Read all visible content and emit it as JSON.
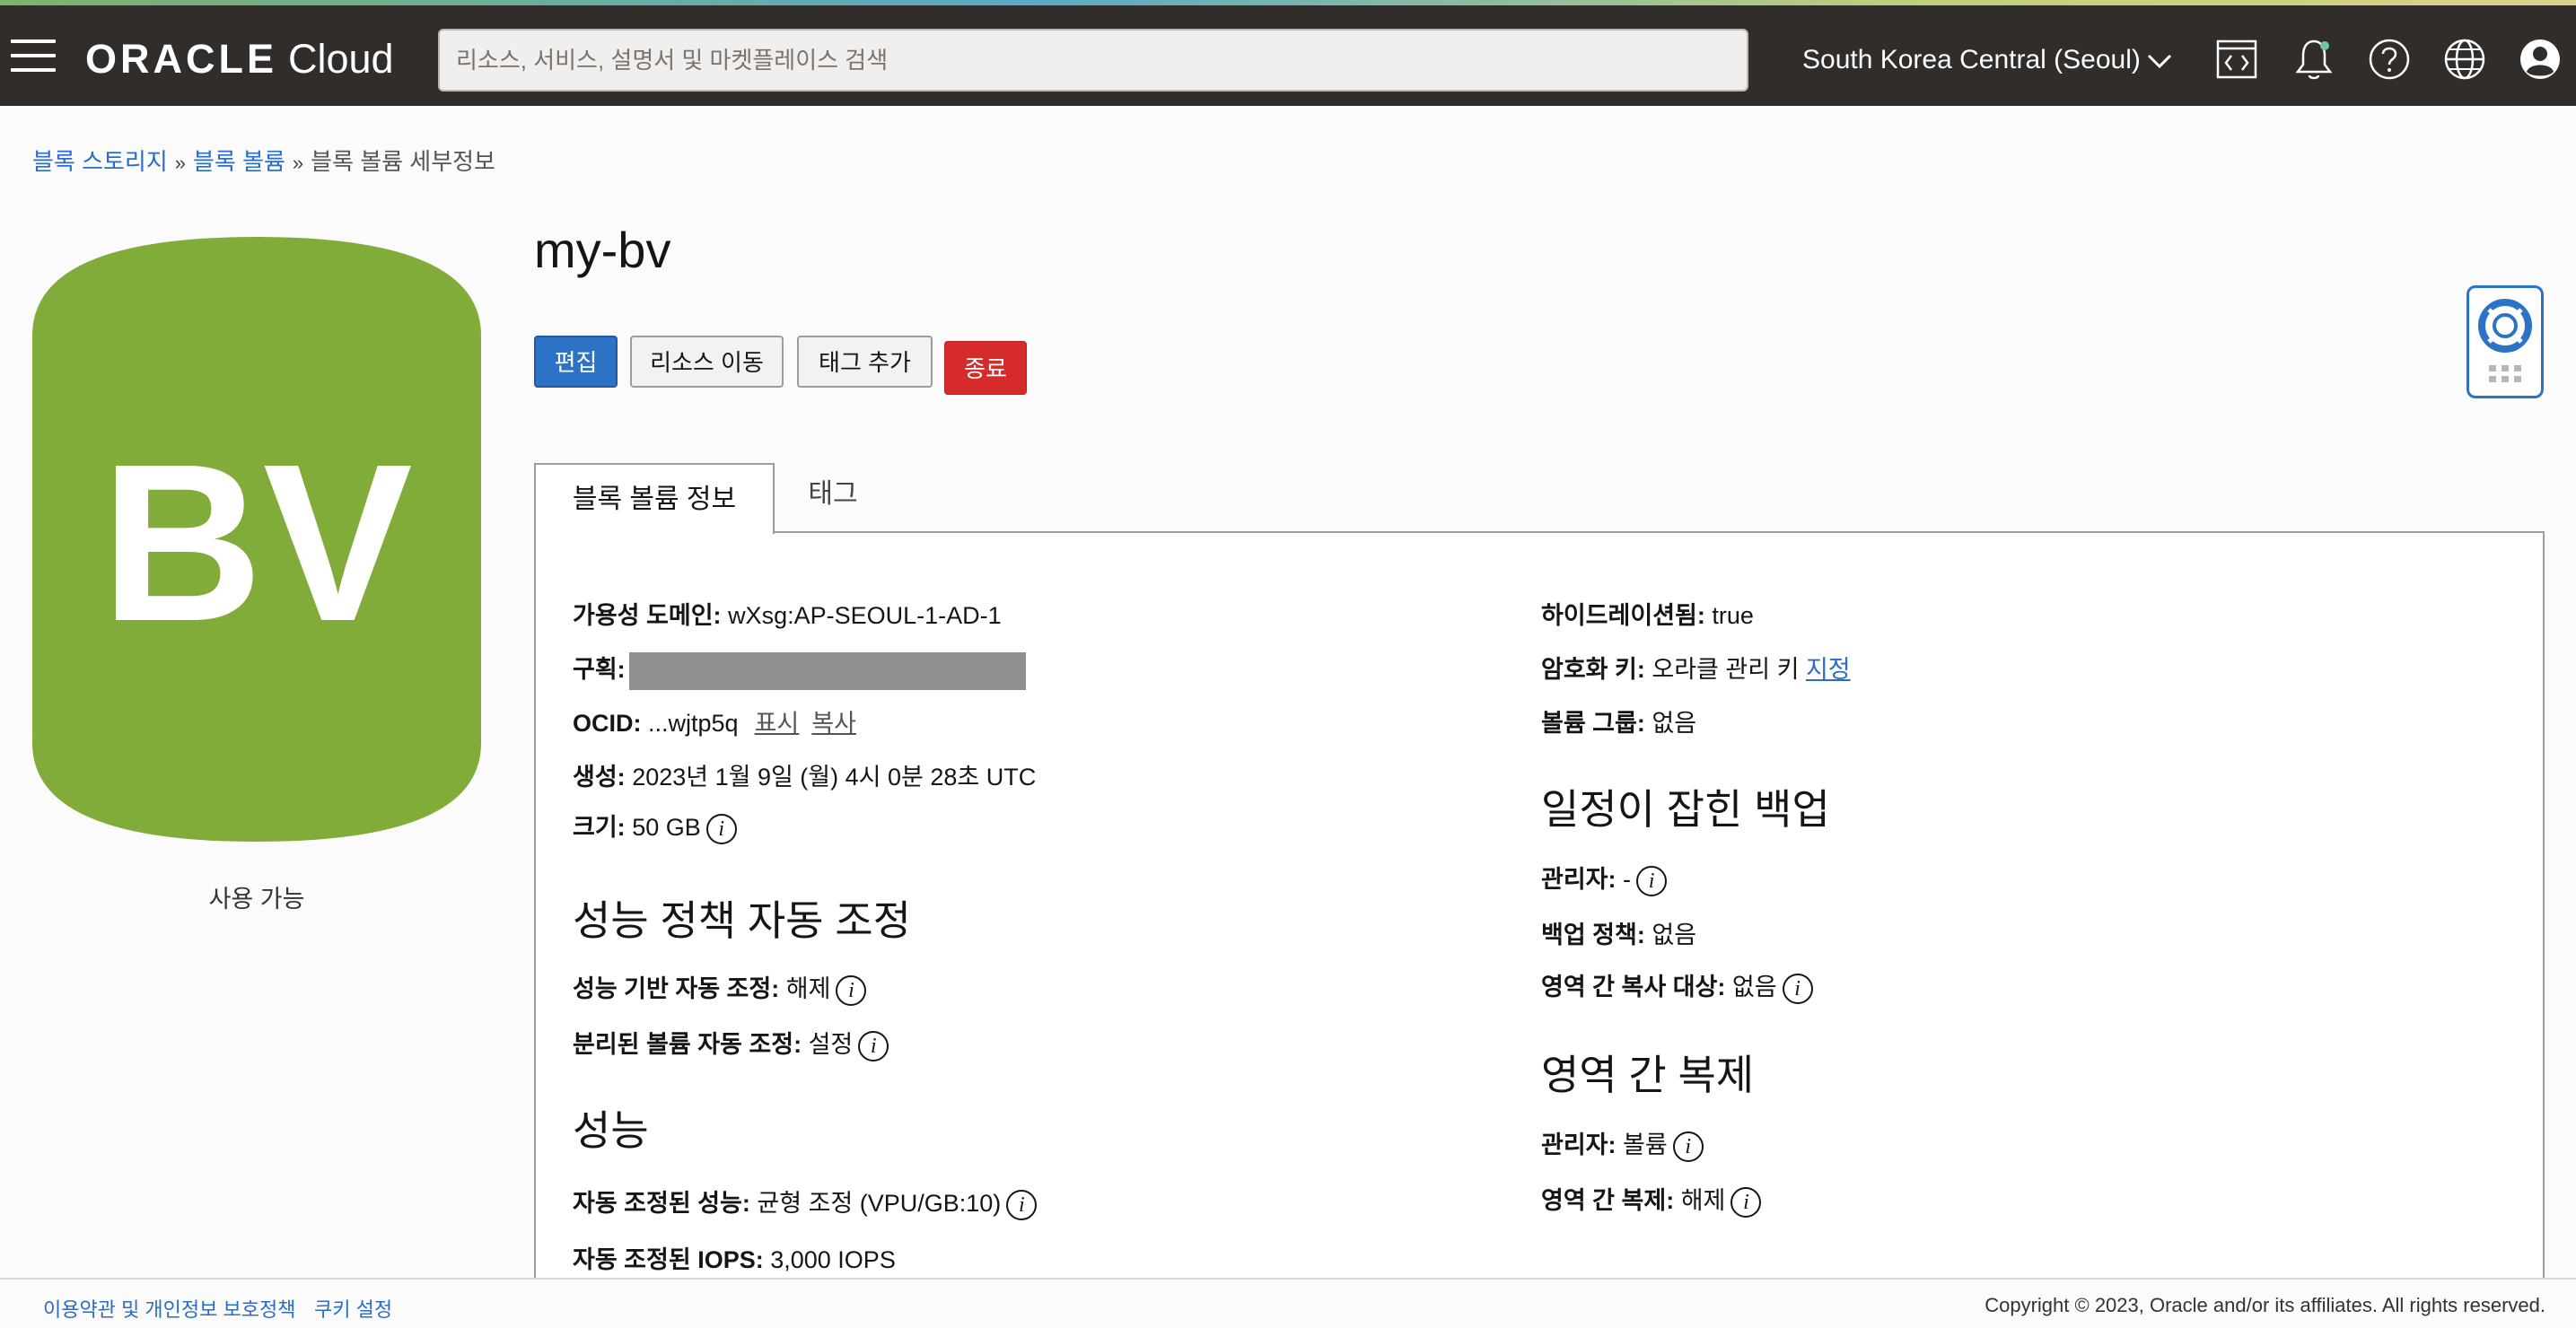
{
  "header": {
    "brand_oracle": "ORACLE",
    "brand_cloud": "Cloud",
    "search_placeholder": "리소스, 서비스, 설명서 및 마켓플레이스 검색",
    "region": "South Korea Central (Seoul)",
    "icons": [
      "menu-icon",
      "code-editor-icon",
      "bell-icon",
      "help-icon",
      "globe-icon",
      "user-icon"
    ]
  },
  "breadcrumb": {
    "items": [
      "블록 스토리지",
      "블록 볼륨"
    ],
    "current": "블록 볼륨 세부정보",
    "separator": "»"
  },
  "resource": {
    "icon_text": "BV",
    "icon_color": "#82ac3a",
    "status": "사용 가능",
    "title": "my-bv"
  },
  "actions": {
    "edit": "편집",
    "move": "리소스 이동",
    "add_tags": "태그 추가",
    "terminate": "종료"
  },
  "tabs": {
    "info": "블록 볼륨 정보",
    "tags": "태그"
  },
  "details_left": {
    "availability_domain_label": "가용성 도메인:",
    "availability_domain_value": "wXsg:AP-SEOUL-1-AD-1",
    "compartment_label": "구획:",
    "ocid_label": "OCID:",
    "ocid_value": "...wjtp5q",
    "ocid_show": "표시",
    "ocid_copy": "복사",
    "created_label": "생성:",
    "created_value": "2023년 1월 9일 (월) 4시 0분 28초 UTC",
    "size_label": "크기:",
    "size_value": "50 GB",
    "perf_policy_heading": "성능 정책 자동 조정",
    "perf_autotune_label": "성능 기반 자동 조정:",
    "perf_autotune_value": "해제",
    "detached_autotune_label": "분리된 볼륨 자동 조정:",
    "detached_autotune_value": "설정",
    "performance_heading": "성능",
    "auto_perf_label": "자동 조정된 성능:",
    "auto_perf_value": "균형 조정 (VPU/GB:10)",
    "auto_iops_label": "자동 조정된 IOPS:",
    "auto_iops_value": "3,000 IOPS"
  },
  "details_right": {
    "hydrated_label": "하이드레이션됨:",
    "hydrated_value": "true",
    "encryption_label": "암호화 키:",
    "encryption_value": "오라클 관리 키",
    "encryption_link": "지정",
    "volume_group_label": "볼륨 그룹:",
    "volume_group_value": "없음",
    "scheduled_backups_heading": "일정이 잡힌 백업",
    "admin_label": "관리자:",
    "admin_value": "-",
    "backup_policy_label": "백업 정책:",
    "backup_policy_value": "없음",
    "cross_region_copy_label": "영역 간 복사 대상:",
    "cross_region_copy_value": "없음",
    "cross_region_repl_heading": "영역 간 복제",
    "repl_admin_label": "관리자:",
    "repl_admin_value": "볼륨",
    "repl_label": "영역 간 복제:",
    "repl_value": "해제"
  },
  "footer": {
    "terms": "이용약관 및 개인정보 보호정책",
    "cookies": "쿠키 설정",
    "copyright": "Copyright © 2023, Oracle and/or its affiliates. All rights reserved."
  }
}
